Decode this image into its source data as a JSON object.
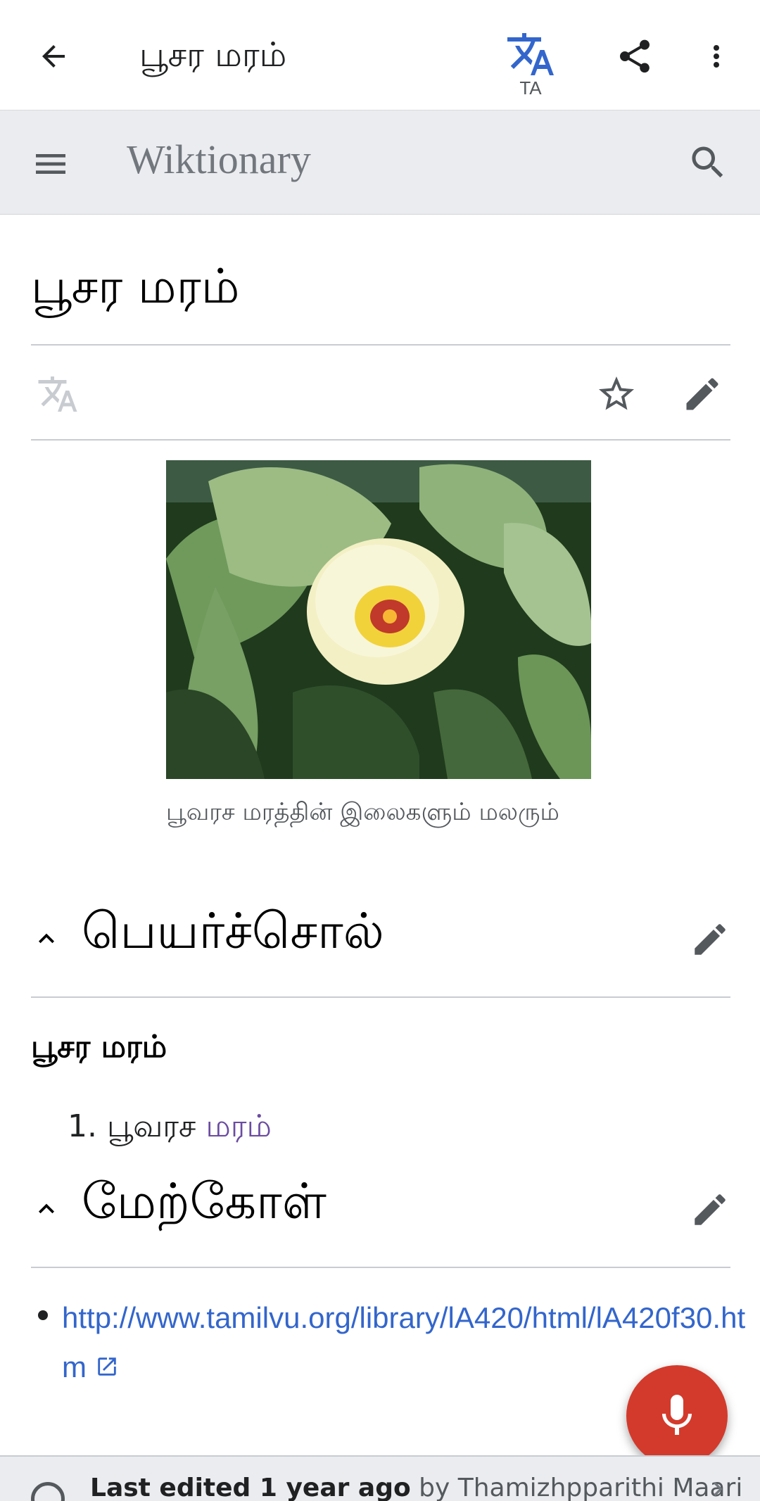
{
  "appbar": {
    "title": "பூசர மரம்",
    "lang_code": "TA"
  },
  "header": {
    "brand": "Wiktionary"
  },
  "article": {
    "title": "பூசர மரம்",
    "image_caption": "பூவரச மரத்தின் இலைகளும் மலரும்",
    "sections": [
      {
        "heading": "பெயர்ச்சொல்",
        "headword": "பூசர மரம்",
        "definitions": [
          {
            "number": "1.",
            "text": "பூவரச ",
            "link": "மரம்"
          }
        ]
      },
      {
        "heading": "மேற்கோள்",
        "references": [
          {
            "url": "http://www.tamilvu.org/library/lA420/html/lA420f30.htm"
          }
        ]
      }
    ]
  },
  "footer": {
    "last_edited": "Last edited 1 year ago",
    "by_text": " by Thamizhpparithi Maari"
  },
  "colors": {
    "accent": "#3366cc",
    "fab": "#d33a2c",
    "visited_link": "#6b4ba1",
    "header_bg": "#eaecf0"
  },
  "icons": {
    "back": "arrow-left-icon",
    "translate": "translate-icon",
    "share": "share-icon",
    "more": "more-vert-icon",
    "menu": "hamburger-menu-icon",
    "search": "search-icon",
    "language": "language-icon",
    "star": "star-outline-icon",
    "edit": "pencil-icon",
    "collapse": "chevron-up-icon",
    "external": "external-link-icon",
    "microphone": "microphone-icon",
    "history": "clock-icon"
  }
}
